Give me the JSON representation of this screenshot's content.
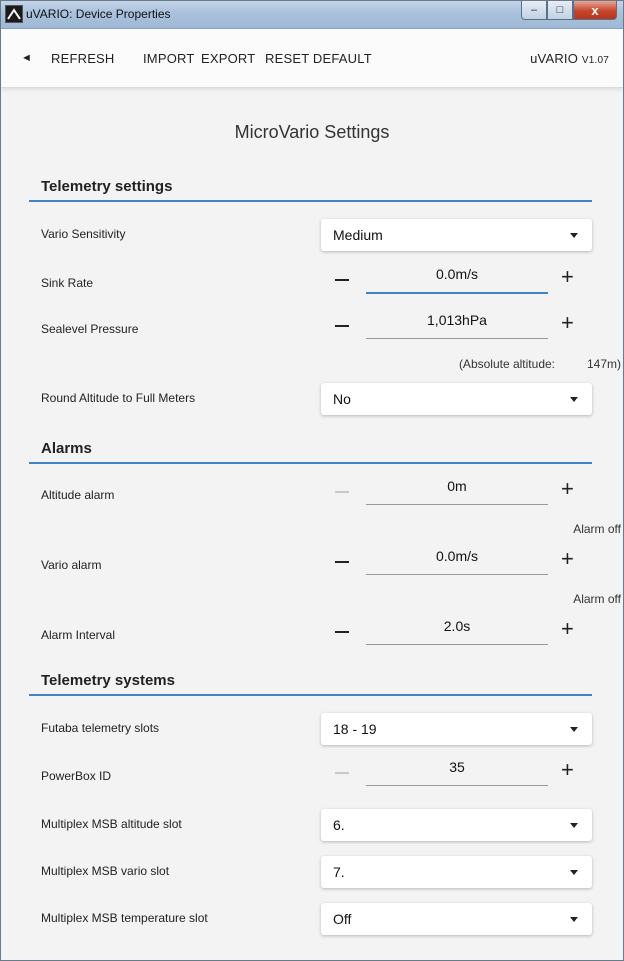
{
  "window": {
    "title": "uVARIO: Device Properties",
    "min": "–",
    "max": "□",
    "close": "x"
  },
  "toolbar": {
    "back": "◄",
    "refresh": "REFRESH",
    "import": "IMPORT",
    "export": "EXPORT",
    "reset": "RESET DEFAULT",
    "app": "uVARIO",
    "version": "V1.07"
  },
  "page_title": "MicroVario Settings",
  "sections": {
    "telemetry_settings": "Telemetry settings",
    "alarms": "Alarms",
    "telemetry_systems": "Telemetry systems"
  },
  "fields": {
    "vario_sensitivity": {
      "label": "Vario Sensitivity",
      "value": "Medium"
    },
    "sink_rate": {
      "label": "Sink Rate",
      "value": "0.0m/s"
    },
    "sealevel_pressure": {
      "label": "Sealevel Pressure",
      "value": "1,013hPa"
    },
    "absolute_altitude": {
      "label": "(Absolute altitude:",
      "value": "147m)"
    },
    "round_altitude": {
      "label": "Round Altitude to Full Meters",
      "value": "No"
    },
    "altitude_alarm": {
      "label": "Altitude alarm",
      "value": "0m",
      "note": "Alarm off"
    },
    "vario_alarm": {
      "label": "Vario alarm",
      "value": "0.0m/s",
      "note": "Alarm off"
    },
    "alarm_interval": {
      "label": "Alarm Interval",
      "value": "2.0s"
    },
    "futaba_slots": {
      "label": "Futaba telemetry slots",
      "value": "18 - 19"
    },
    "powerbox_id": {
      "label": "PowerBox ID",
      "value": "35"
    },
    "msb_altitude": {
      "label": "Multiplex MSB altitude slot",
      "value": "6."
    },
    "msb_vario": {
      "label": "Multiplex MSB vario slot",
      "value": "7."
    },
    "msb_temperature": {
      "label": "Multiplex MSB temperature slot",
      "value": "Off"
    }
  },
  "controls": {
    "minus": "—",
    "plus": "+"
  }
}
